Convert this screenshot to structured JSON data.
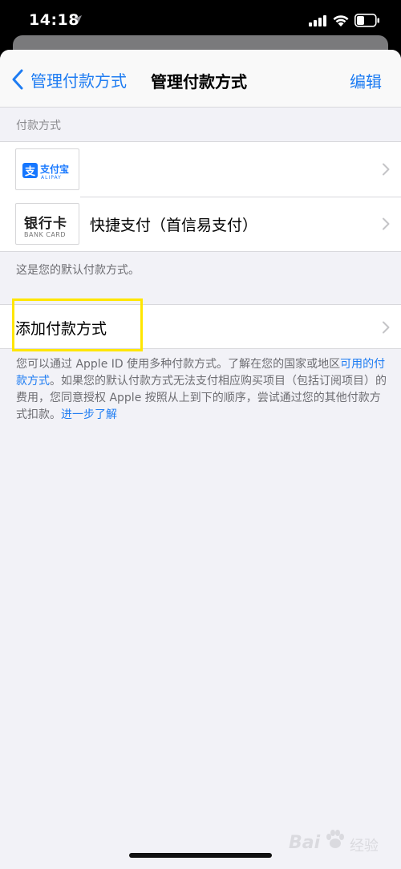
{
  "status_bar": {
    "time": "14:18"
  },
  "nav": {
    "back_label": "管理付款方式",
    "title": "管理付款方式",
    "edit_label": "编辑"
  },
  "payment_section": {
    "header": "付款方式",
    "methods": [
      {
        "logo_cn": "支付宝",
        "logo_en": "ALIPAY",
        "logo_mark": "支",
        "label": ""
      },
      {
        "logo_cn": "银行卡",
        "logo_en": "BANK CARD",
        "label": "快捷支付（首信易支付）"
      }
    ],
    "default_note": "这是您的默认付款方式。"
  },
  "add_payment": {
    "label": "添加付款方式"
  },
  "footer": {
    "part1": "您可以通过 Apple ID 使用多种付款方式。了解在您的国家或地区",
    "link1": "可用的付款方式",
    "part2": "。如果您的默认付款方式无法支付相应购买项目（包括订阅项目）的费用，您同意授权 Apple 按照从上到下的顺序，尝试通过您的其他付款方式扣款。",
    "link2": "进一步了解"
  },
  "watermark": {
    "text": "Bai",
    "jy": "经验"
  },
  "colors": {
    "accent": "#1e7cf2",
    "alipay": "#1677ff",
    "highlight": "#ffe600",
    "background": "#f2f2f7"
  }
}
